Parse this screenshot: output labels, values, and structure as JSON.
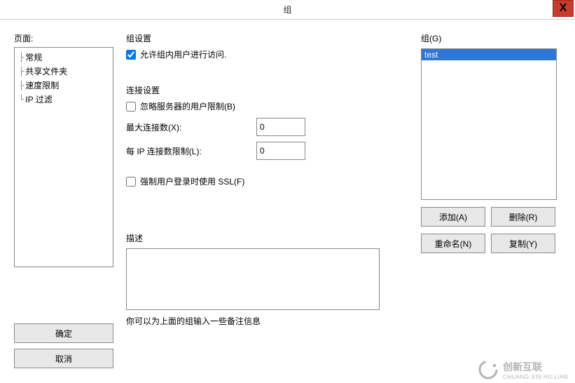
{
  "window": {
    "title": "组",
    "close_icon": "X"
  },
  "sidebar": {
    "label": "页面:",
    "items": [
      {
        "label": "常规"
      },
      {
        "label": "共享文件夹"
      },
      {
        "label": "速度限制"
      },
      {
        "label": "IP 过滤"
      }
    ],
    "ok_label": "确定",
    "cancel_label": "取消"
  },
  "group_settings": {
    "title": "组设置",
    "allow_access_label": "允许组内用户进行访问.",
    "allow_access_checked": true
  },
  "conn_settings": {
    "title": "连接设置",
    "bypass_label": "忽略服务器的用户限制(B)",
    "bypass_checked": false,
    "max_conn_label": "最大连接数(X):",
    "max_conn_value": "0",
    "per_ip_label": "每 IP 连接数限制(L):",
    "per_ip_value": "0",
    "force_ssl_label": "强制用户登录时使用 SSL(F)",
    "force_ssl_checked": false
  },
  "description": {
    "title": "描述",
    "value": "",
    "hint": "你可以为上面的组输入一些备注信息"
  },
  "groups_panel": {
    "title": "组(G)",
    "items": [
      {
        "label": "test",
        "selected": true
      }
    ],
    "add_label": "添加(A)",
    "delete_label": "删除(R)",
    "rename_label": "重命名(N)",
    "copy_label": "复制(Y)"
  },
  "watermark": {
    "brand": "创新互联",
    "sub": "CHUANG.XIN.HU.LIAN"
  }
}
